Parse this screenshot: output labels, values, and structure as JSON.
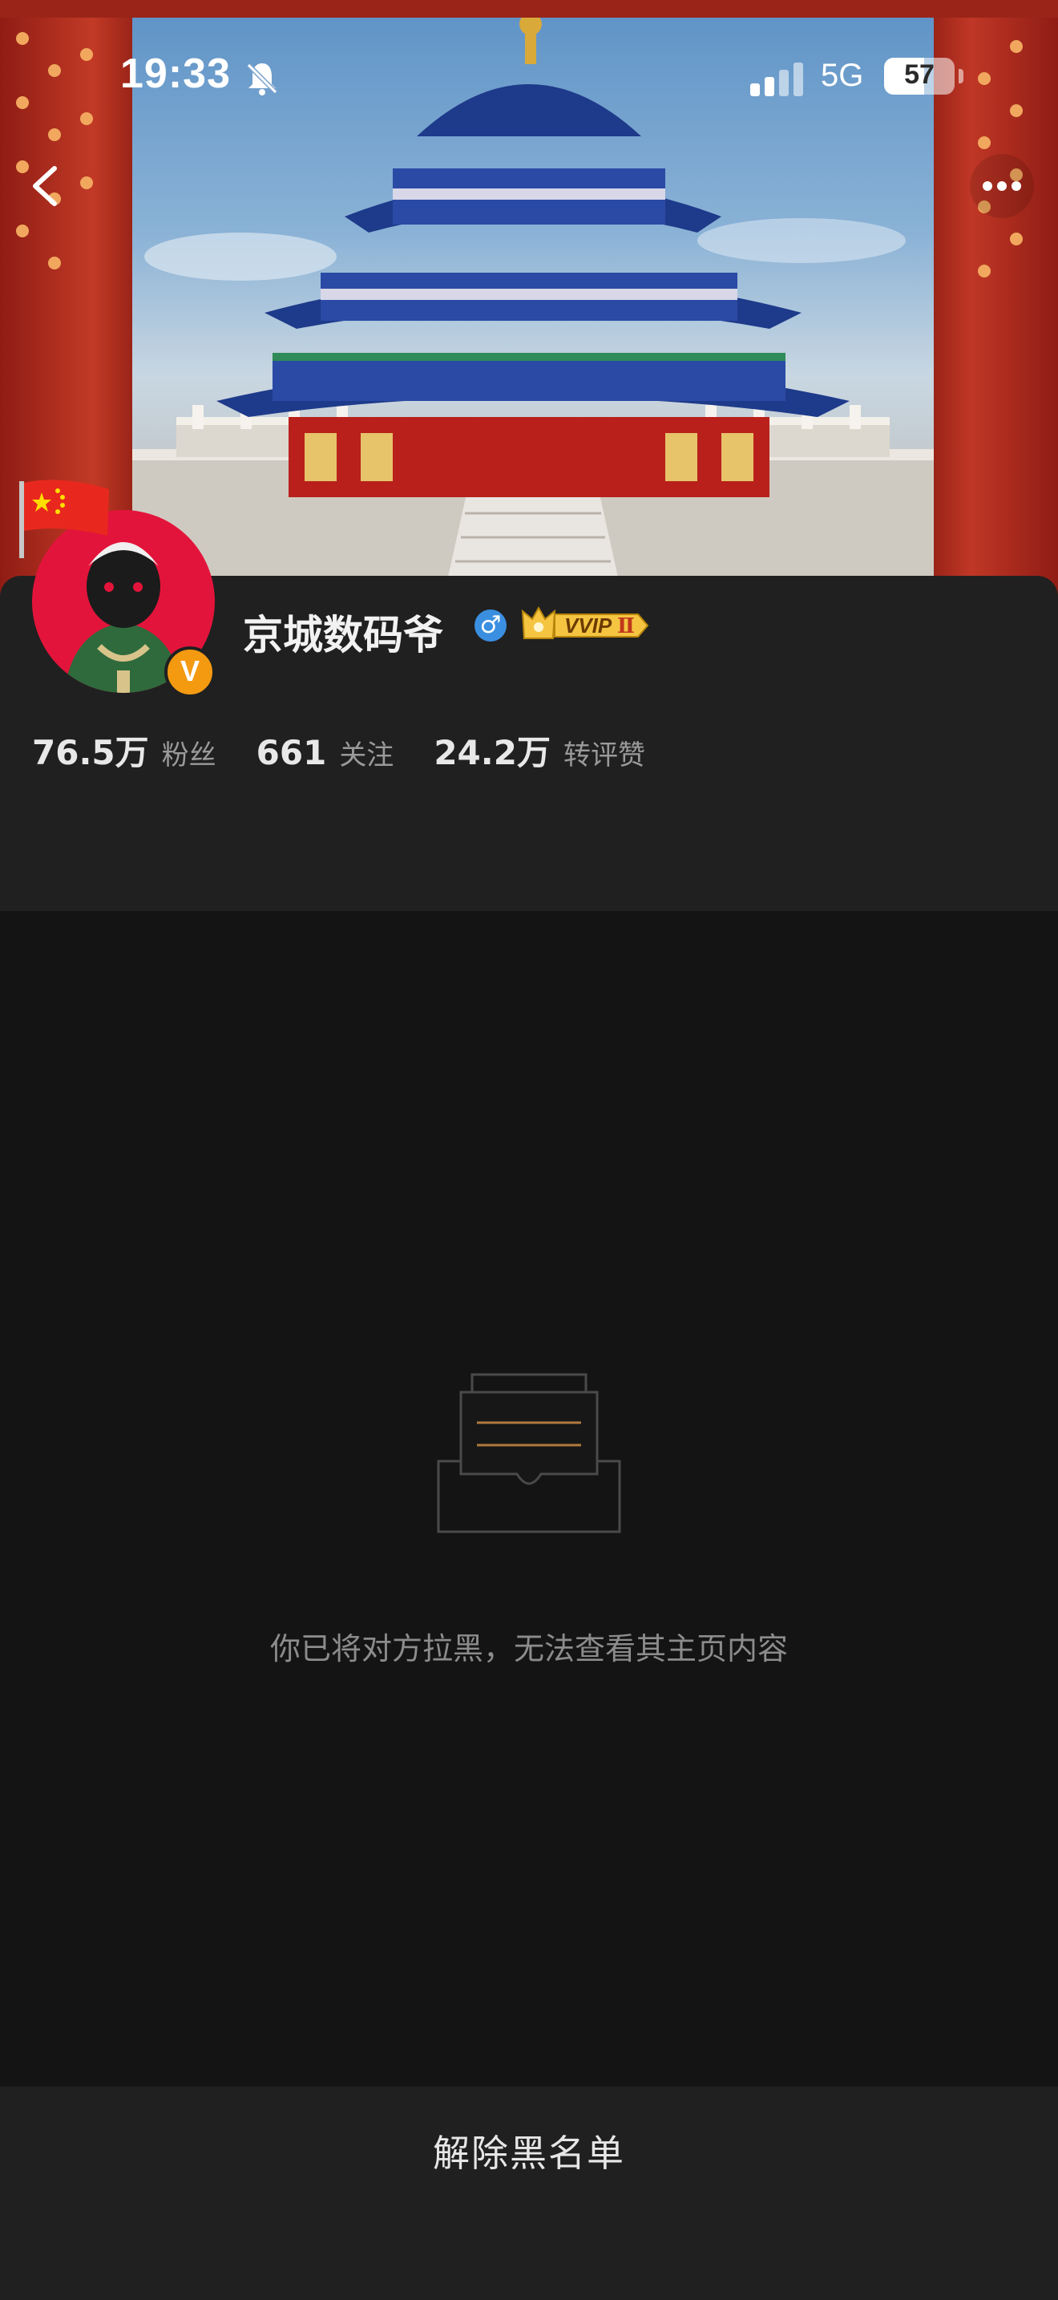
{
  "status_bar": {
    "time": "19:33",
    "network": "5G",
    "battery": "57",
    "battery_level": 0.57,
    "icons": [
      "bell-muted-icon",
      "signal-icon",
      "battery-icon"
    ]
  },
  "nav": {
    "icons": [
      "back-arrow-icon",
      "more-dots-icon"
    ]
  },
  "profile": {
    "name": "京城数码爷",
    "gender_symbol": "♂",
    "vip_label": "VVIP",
    "vip_level": "Ⅱ",
    "verified_mark": "V",
    "stats": [
      {
        "value": "76.5万",
        "label": "粉丝"
      },
      {
        "value": "661",
        "label": "关注"
      },
      {
        "value": "24.2万",
        "label": "转评赞"
      }
    ]
  },
  "empty_state": {
    "message": "你已将对方拉黑，无法查看其主页内容",
    "icon": "inbox-tray-icon"
  },
  "actions": {
    "unblock_label": "解除黑名单"
  },
  "colors": {
    "background": "#141414",
    "card": "#202020",
    "verified_badge": "#f39a11",
    "avatar_bg": "#e3143b",
    "gender_badge": "#3b8fe0",
    "vip_gold": "#f5c542"
  }
}
